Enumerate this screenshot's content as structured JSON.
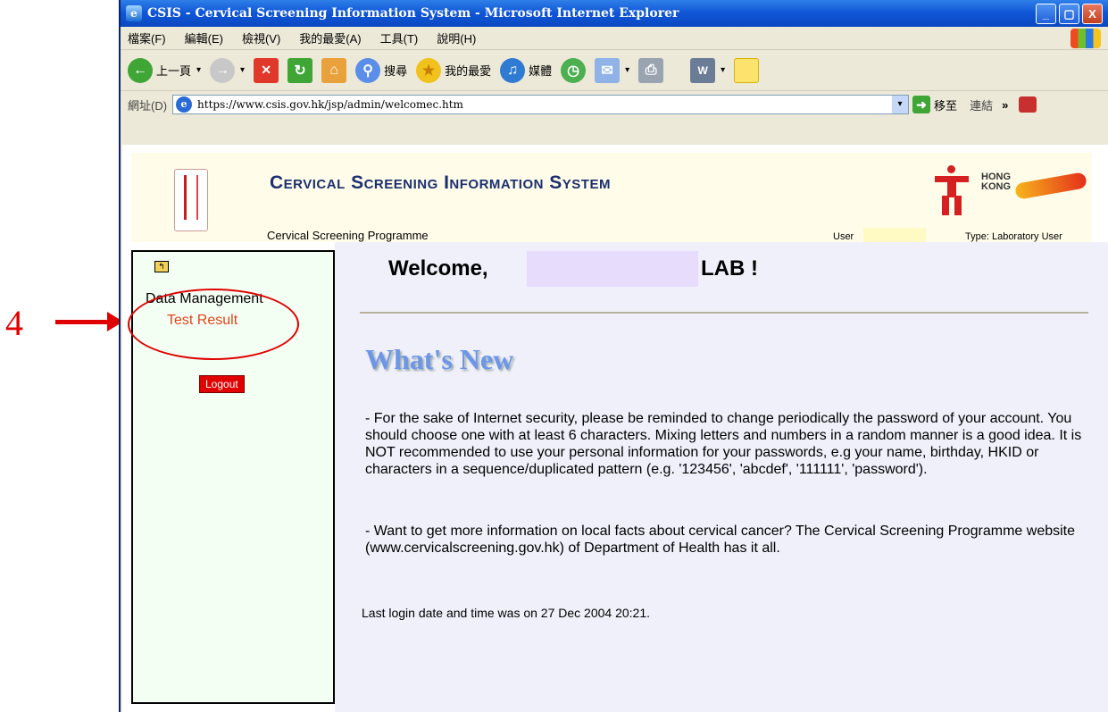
{
  "annotation": {
    "step_number": "4"
  },
  "window": {
    "title": "CSIS - Cervical Screening Information System - Microsoft Internet Explorer",
    "controls": {
      "minimize": "_",
      "maximize": "▢",
      "close": "X"
    }
  },
  "menubar": {
    "items": [
      "檔案(F)",
      "編輯(E)",
      "檢視(V)",
      "我的最愛(A)",
      "工具(T)",
      "說明(H)"
    ]
  },
  "toolbar": {
    "back_label": "上一頁",
    "search_label": "搜尋",
    "favorites_label": "我的最愛",
    "media_label": "媒體"
  },
  "addressbar": {
    "label": "網址(D)",
    "url": "https://www.csis.gov.hk/jsp/admin/welcomec.htm",
    "go_label": "移至",
    "links_label": "連結",
    "more": "»"
  },
  "header": {
    "title": "Cervical Screening Information System",
    "subtitle": "Cervical Screening Programme",
    "hk_logo_line1": "HONG",
    "hk_logo_line2": "KONG",
    "user_label": "User",
    "user_type": "Type: Laboratory User"
  },
  "sidebar": {
    "folder_glyph": "↰",
    "section": "Data Management",
    "link": "Test Result",
    "logout": "Logout"
  },
  "main": {
    "welcome": "Welcome,",
    "lab": "LAB !",
    "whats_new": "What's New",
    "paragraph1": "- For the sake of Internet security, please be reminded to change periodically the password of your account. You should choose one with at least 6 characters. Mixing letters and numbers in a random manner is a good idea. It is NOT recommended to use your personal information for your passwords, e.g your name, birthday, HKID or characters in a sequence/duplicated pattern (e.g. '123456', 'abcdef', '111111', 'password').",
    "paragraph2": "- Want to get more information on local facts about cervical cancer? The Cervical Screening Programme website (www.cervicalscreening.gov.hk) of Department of Health has it all.",
    "last_login": "Last login date and time was on 27 Dec 2004 20:21."
  }
}
